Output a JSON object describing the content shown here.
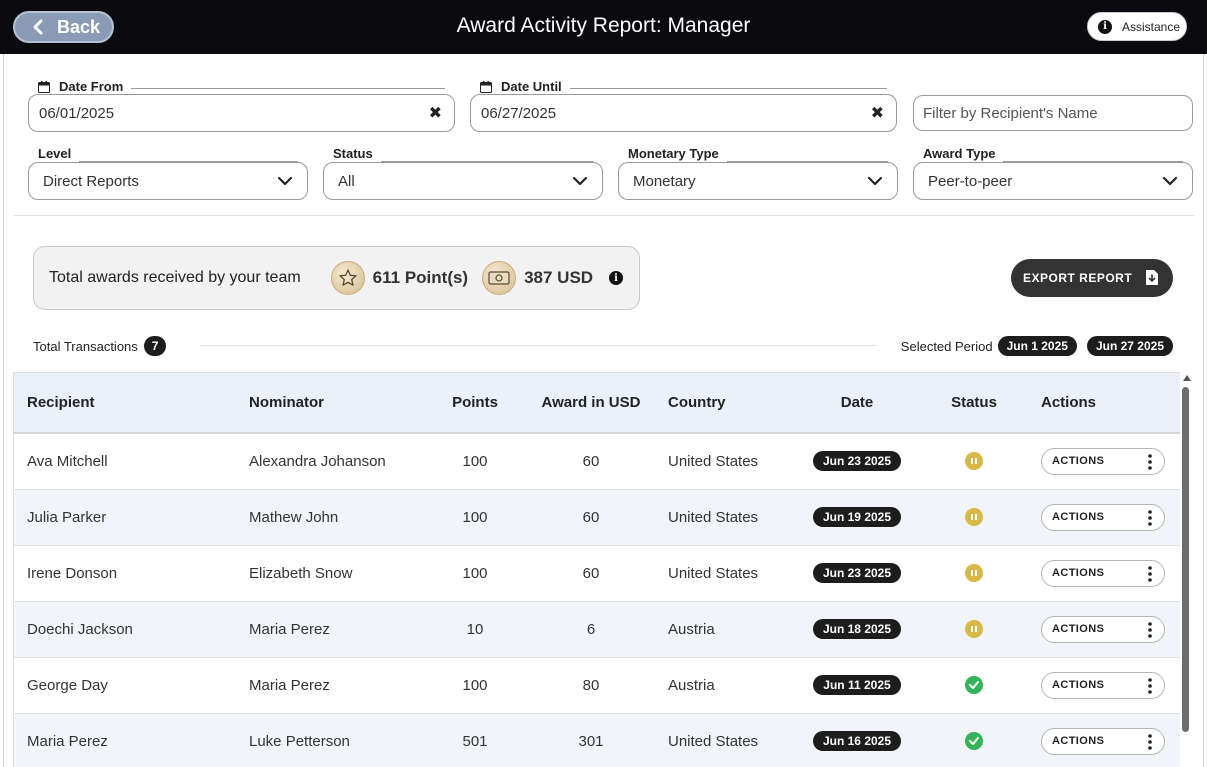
{
  "header": {
    "back_label": "Back",
    "title": "Award Activity Report: Manager",
    "assistance_label": "Assistance"
  },
  "filters": {
    "date_from": {
      "label": "Date From",
      "value": "06/01/2025"
    },
    "date_until": {
      "label": "Date Until",
      "value": "06/27/2025"
    },
    "recipient_search": {
      "placeholder": "Filter by Recipient's Name"
    },
    "level": {
      "label": "Level",
      "value": "Direct Reports"
    },
    "status": {
      "label": "Status",
      "value": "All"
    },
    "monetary_type": {
      "label": "Monetary Type",
      "value": "Monetary"
    },
    "award_type": {
      "label": "Award Type",
      "value": "Peer-to-peer"
    }
  },
  "summary": {
    "label": "Total awards received by your team",
    "points": "611 Point(s)",
    "usd": "387 USD",
    "icons": [
      "star-coin-icon",
      "cash-coin-icon",
      "info-icon"
    ]
  },
  "export_label": "EXPORT REPORT",
  "transactions": {
    "label": "Total Transactions",
    "count": "7",
    "period_label": "Selected Period",
    "period_start": "Jun 1 2025",
    "period_end": "Jun 27 2025"
  },
  "table": {
    "columns": [
      "Recipient",
      "Nominator",
      "Points",
      "Award in USD",
      "Country",
      "Date",
      "Status",
      "Actions"
    ],
    "rows": [
      {
        "recipient": "Ava Mitchell",
        "nominator": "Alexandra Johanson",
        "points": "100",
        "usd": "60",
        "country": "United States",
        "date": "Jun 23 2025",
        "status": "pending",
        "action": "ACTIONS"
      },
      {
        "recipient": "Julia Parker",
        "nominator": "Mathew John",
        "points": "100",
        "usd": "60",
        "country": "United States",
        "date": "Jun 19 2025",
        "status": "pending",
        "action": "ACTIONS"
      },
      {
        "recipient": "Irene Donson",
        "nominator": "Elizabeth Snow",
        "points": "100",
        "usd": "60",
        "country": "United States",
        "date": "Jun 23 2025",
        "status": "pending",
        "action": "ACTIONS"
      },
      {
        "recipient": "Doechi Jackson",
        "nominator": "Maria Perez",
        "points": "10",
        "usd": "6",
        "country": "Austria",
        "date": "Jun 18 2025",
        "status": "pending",
        "action": "ACTIONS"
      },
      {
        "recipient": "George Day",
        "nominator": "Maria Perez",
        "points": "100",
        "usd": "80",
        "country": "Austria",
        "date": "Jun 11 2025",
        "status": "approved",
        "action": "ACTIONS"
      },
      {
        "recipient": "Maria Perez",
        "nominator": "Luke Petterson",
        "points": "501",
        "usd": "301",
        "country": "United States",
        "date": "Jun 16 2025",
        "status": "approved",
        "action": "ACTIONS"
      }
    ]
  },
  "colors": {
    "topbar": "#0b0b0f",
    "back_button": "#8a9bb5",
    "pending": "#d8b847",
    "approved": "#35b35a",
    "header_row": "#eaf1fa"
  }
}
